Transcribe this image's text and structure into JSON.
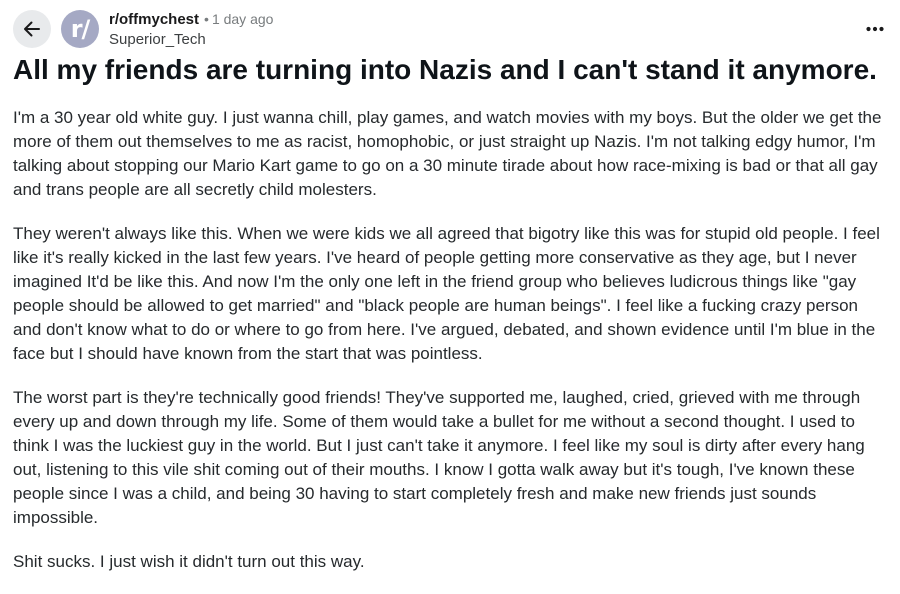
{
  "header": {
    "subreddit": "r/offmychest",
    "separator": "•",
    "time_ago": "1 day ago",
    "username": "Superior_Tech",
    "avatar_text": "r/"
  },
  "icons": {
    "back": "arrow-left-icon",
    "more": "ellipsis-horizontal-icon"
  },
  "colors": {
    "avatar_bg": "#a5a9c4",
    "back_button_bg": "#e8eaec",
    "text": "#1a1a1b",
    "muted": "#787c7e"
  },
  "post": {
    "title": "All my friends are turning into Nazis and I can't stand it anymore.",
    "paragraphs": [
      "I'm a 30 year old white guy. I just wanna chill, play games, and watch movies with my boys. But the older we get the more of them out themselves to me as racist, homophobic, or just straight up Nazis. I'm not talking edgy humor, I'm talking about stopping our Mario Kart game to go on a 30 minute tirade about how race-mixing is bad or that all gay and trans people are all secretly child molesters.",
      "They weren't always like this. When we were kids we all agreed that bigotry like this was for stupid old people. I feel like it's really kicked in the last few years. I've heard of people getting more conservative as they age, but I never imagined It'd be like this. And now I'm the only one left in the friend group who believes ludicrous things like \"gay people should be allowed to get married\" and \"black people are human beings\". I feel like a fucking crazy person and don't know what to do or where to go from here. I've argued, debated, and shown evidence until I'm blue in the face but I should have known from the start that was pointless.",
      "The worst part is they're technically good friends! They've supported me, laughed, cried, grieved with me through every up and down through my life. Some of them would take a bullet for me without a second thought. I used to think I was the luckiest guy in the world. But I just can't take it anymore. I feel like my soul is dirty after every hang out, listening to this vile shit coming out of their mouths. I know I gotta walk away but it's tough, I've known these people since I was a child, and being 30 having to start completely fresh and make new friends just sounds impossible.",
      "Shit sucks. I just wish it didn't turn out this way."
    ]
  }
}
